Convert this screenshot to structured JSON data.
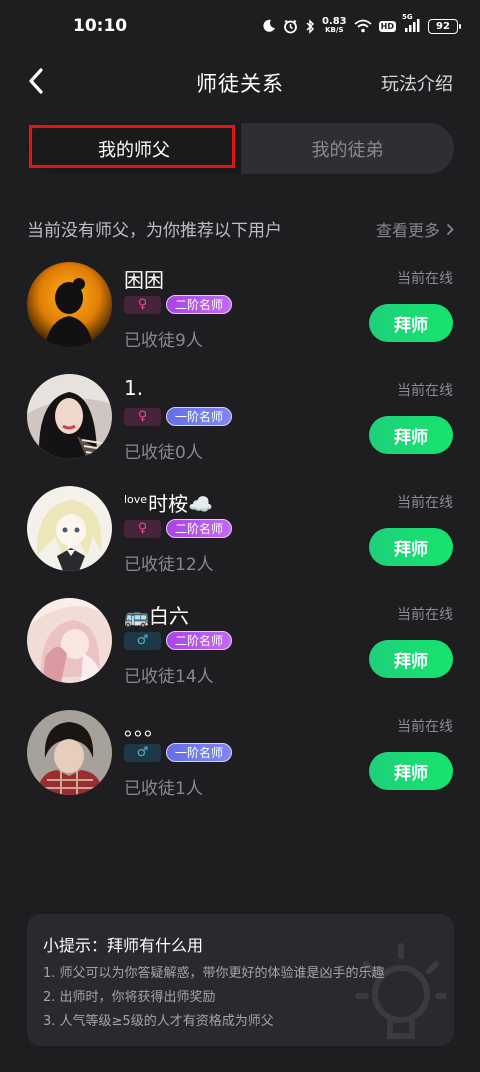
{
  "status_bar": {
    "time": "10:10",
    "net_speed_value": "0.83",
    "net_speed_unit": "KB/S",
    "hd_label": "HD",
    "signal_label": "5G",
    "battery_level": "92"
  },
  "header": {
    "title": "师徒关系",
    "rules_label": "玩法介绍"
  },
  "tabs": {
    "active_label": "我的师父",
    "inactive_label": "我的徒弟"
  },
  "recommend": {
    "title": "当前没有师父，为你推荐以下用户",
    "see_more_label": "查看更多"
  },
  "users": [
    {
      "name": "困困",
      "gender": "female",
      "level": "二阶名师",
      "count": "已收徒9人",
      "status": "当前在线",
      "button": "拜师"
    },
    {
      "name": "1.",
      "gender": "female",
      "level": "一阶名师",
      "count": "已收徒0人",
      "status": "当前在线",
      "button": "拜师"
    },
    {
      "name_prefix": "love",
      "name": "时桉☁️",
      "gender": "female",
      "level": "二阶名师",
      "count": "已收徒12人",
      "status": "当前在线",
      "button": "拜师"
    },
    {
      "name": "🚌白六",
      "gender": "male",
      "level": "二阶名师",
      "count": "已收徒14人",
      "status": "当前在线",
      "button": "拜师"
    },
    {
      "name": "。。。",
      "gender": "male",
      "level": "一阶名师",
      "count": "已收徒1人",
      "status": "当前在线",
      "button": "拜师"
    }
  ],
  "tips": {
    "title": "小提示：拜师有什么用",
    "lines": [
      "1. 师父可以为你答疑解惑，带你更好的体验谁是凶手的乐趣",
      "2. 出师时，你将获得出师奖励",
      "3. 人气等级≥5级的人才有资格成为师父"
    ]
  },
  "colors": {
    "background": "#1e1e21",
    "accent_green": "#1fd07a",
    "highlight_red": "#e01515",
    "tier2_purple": "#a845e6",
    "tier1_blue": "#6470e6"
  },
  "icons": {
    "back": "chevron-left-icon",
    "see_more": "chevron-right-icon",
    "female": "female-icon",
    "male": "male-icon",
    "tips_decoration": "lightbulb-icon"
  }
}
